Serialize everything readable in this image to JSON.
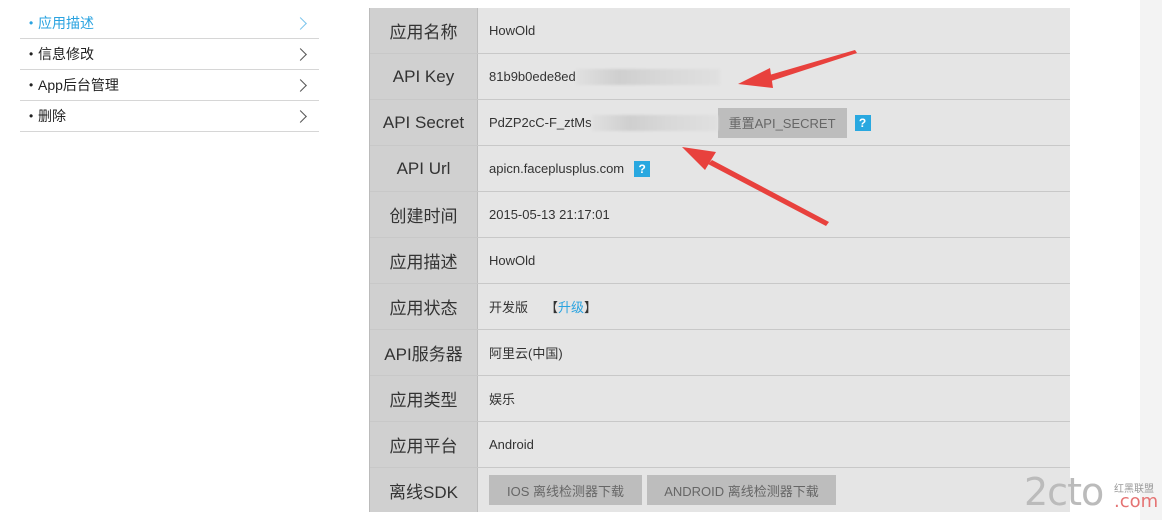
{
  "sidebar": {
    "items": [
      {
        "label": "应用描述",
        "active": true
      },
      {
        "label": "信息修改",
        "active": false
      },
      {
        "label": "App后台管理",
        "active": false
      },
      {
        "label": "删除",
        "active": false
      }
    ]
  },
  "info": {
    "app_name_label": "应用名称",
    "app_name_value": "HowOld",
    "api_key_label": "API Key",
    "api_key_value": "81b9b0ede8ed",
    "api_secret_label": "API Secret",
    "api_secret_value": "PdZP2cC-F_ztMs",
    "reset_secret_button": "重置API_SECRET",
    "api_url_label": "API Url",
    "api_url_value": "apicn.faceplusplus.com",
    "created_label": "创建时间",
    "created_value": "2015-05-13 21:17:01",
    "desc_label": "应用描述",
    "desc_value": "HowOld",
    "status_label": "应用状态",
    "status_value": "开发版",
    "upgrade_open": "【",
    "upgrade_link": "升级",
    "upgrade_close": "】",
    "server_label": "API服务器",
    "server_value": "阿里云(中国)",
    "type_label": "应用类型",
    "type_value": "娱乐",
    "platform_label": "应用平台",
    "platform_value": "Android",
    "sdk_label": "离线SDK",
    "ios_sdk_button": "IOS 离线检测器下载",
    "android_sdk_button": "ANDROID 离线检测器下载",
    "help_glyph": "?"
  },
  "watermark": {
    "text": "2cto",
    "suffix": ".com",
    "cn": "红黑联盟"
  },
  "colors": {
    "accent": "#2aa3e0",
    "arrow": "#e8413d",
    "label_bg": "#d0d0d0",
    "value_bg": "#e5e5e5"
  }
}
